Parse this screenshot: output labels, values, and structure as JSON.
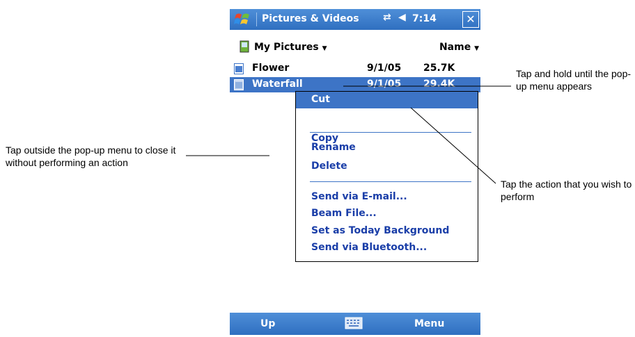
{
  "title_bar": {
    "app_title": "Pictures & Videos",
    "time": "7:14",
    "close_glyph": "✕",
    "connectivity_icon": "connectivity-icon",
    "volume_icon": "volume-icon"
  },
  "folder_bar": {
    "folder": "My Pictures",
    "sort": "Name",
    "dropdown_glyph": "▼"
  },
  "files": [
    {
      "name": "Flower",
      "date": "9/1/05",
      "size": "25.7K"
    },
    {
      "name": "Waterfall",
      "date": "9/1/05",
      "size": "29.4K"
    }
  ],
  "context_menu": {
    "items": [
      "Cut",
      "Copy",
      "Rename",
      "Delete",
      "Send via E-mail...",
      "Beam File...",
      "Set as Today Background",
      "Send via Bluetooth..."
    ],
    "selected": "Cut"
  },
  "bottom_bar": {
    "left": "Up",
    "right": "Menu"
  },
  "callouts": {
    "outside": "Tap outside the pop-up menu to close it without performing an action",
    "hold": "Tap and hold until the pop-up menu appears",
    "action": "Tap the action that you wish to perform"
  },
  "colors": {
    "title_bar": "#2f6fc0",
    "highlight": "#3d74c6",
    "menu_text": "#1a3ea8"
  }
}
